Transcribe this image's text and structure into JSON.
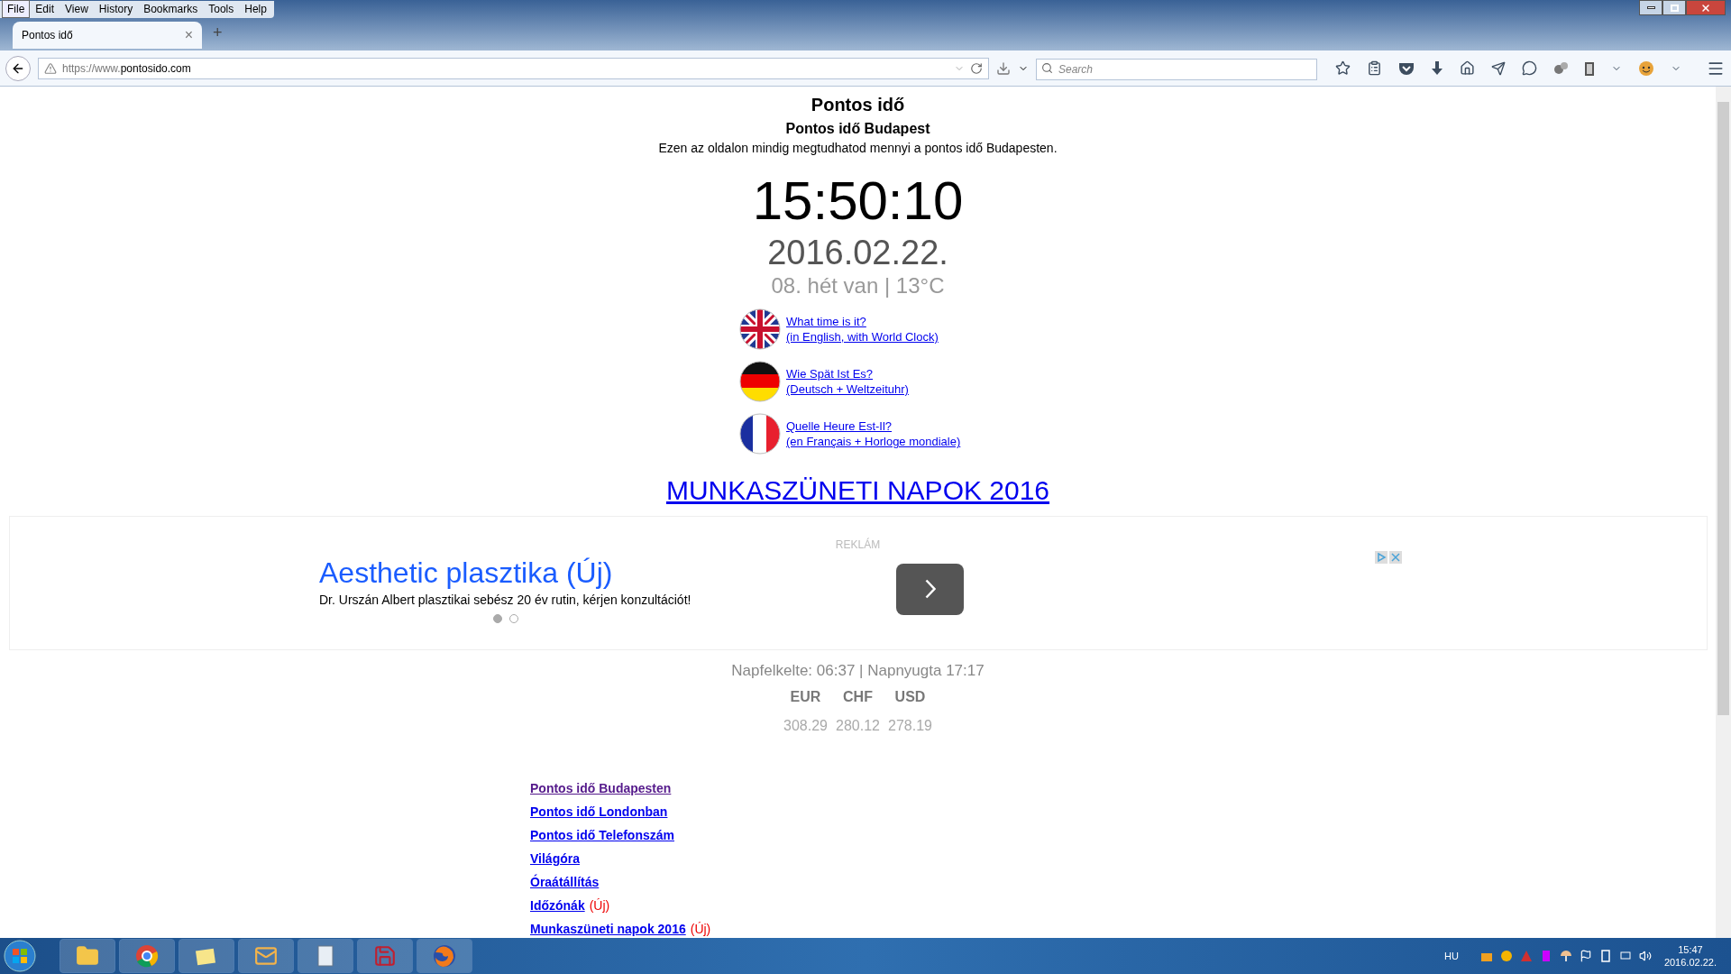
{
  "menu_bar": {
    "items": [
      {
        "label": "File",
        "selected": true
      },
      {
        "label": "Edit",
        "selected": false
      },
      {
        "label": "View",
        "selected": false
      },
      {
        "label": "History",
        "selected": false
      },
      {
        "label": "Bookmarks",
        "selected": false
      },
      {
        "label": "Tools",
        "selected": false
      },
      {
        "label": "Help",
        "selected": false
      }
    ]
  },
  "tabs": [
    {
      "title": "Pontos idő",
      "selected": true,
      "close": "×"
    }
  ],
  "new_tab": "+",
  "address_bar": {
    "scheme": "https://www.",
    "domain": "pontosido.com"
  },
  "search": {
    "placeholder": "Search"
  },
  "page": {
    "title": "Pontos idő",
    "subtitle": "Pontos idő Budapest",
    "description": "Ezen az oldalon mindig megtudhatod mennyi a pontos idő Budapesten.",
    "clock": "15:50:10",
    "date": "2016.02.22.",
    "week_weather": "08. hét van | 13°C",
    "language_links": [
      {
        "kind": "uk",
        "line1": "What time is it?",
        "line2": "(in English, with World Clock)"
      },
      {
        "kind": "de",
        "line1": "Wie Spät Ist Es?",
        "line2": "(Deutsch + Weltzeituhr)"
      },
      {
        "kind": "fr",
        "line1": "Quelle Heure Est-Il?",
        "line2": "(en Français + Horloge mondiale)"
      }
    ],
    "holidays_link": "MUNKASZÜNETI NAPOK 2016",
    "ad": {
      "label": "REKLÁM",
      "title": "Aesthetic plasztika (Új)",
      "text": "Dr. Urszán Albert plasztikai sebész 20 év rutin, kérjen konzultációt!",
      "dots": [
        {
          "selected": true
        },
        {
          "selected": false
        }
      ]
    },
    "sun": "Napfelkelte: 06:37 | Napnyugta 17:17",
    "currencies": [
      {
        "code": "EUR",
        "rate": "308.29"
      },
      {
        "code": "CHF",
        "rate": "280.12"
      },
      {
        "code": "USD",
        "rate": "278.19"
      }
    ],
    "links": [
      {
        "text": "Pontos idő Budapesten",
        "visited": true
      },
      {
        "text": "Pontos idő Londonban",
        "visited": false
      },
      {
        "text": "Pontos idő Telefonszám",
        "visited": false
      },
      {
        "text": "Világóra",
        "visited": false
      },
      {
        "text": "Óraátállítás",
        "visited": false
      },
      {
        "text": "Időzónák",
        "visited": false,
        "badge": "(Új)"
      },
      {
        "text": "Munkaszüneti napok 2016",
        "visited": false,
        "badge": "(Új)"
      }
    ]
  },
  "taskbar": {
    "language": "HU",
    "time": "15:47",
    "date": "2016.02.22."
  }
}
